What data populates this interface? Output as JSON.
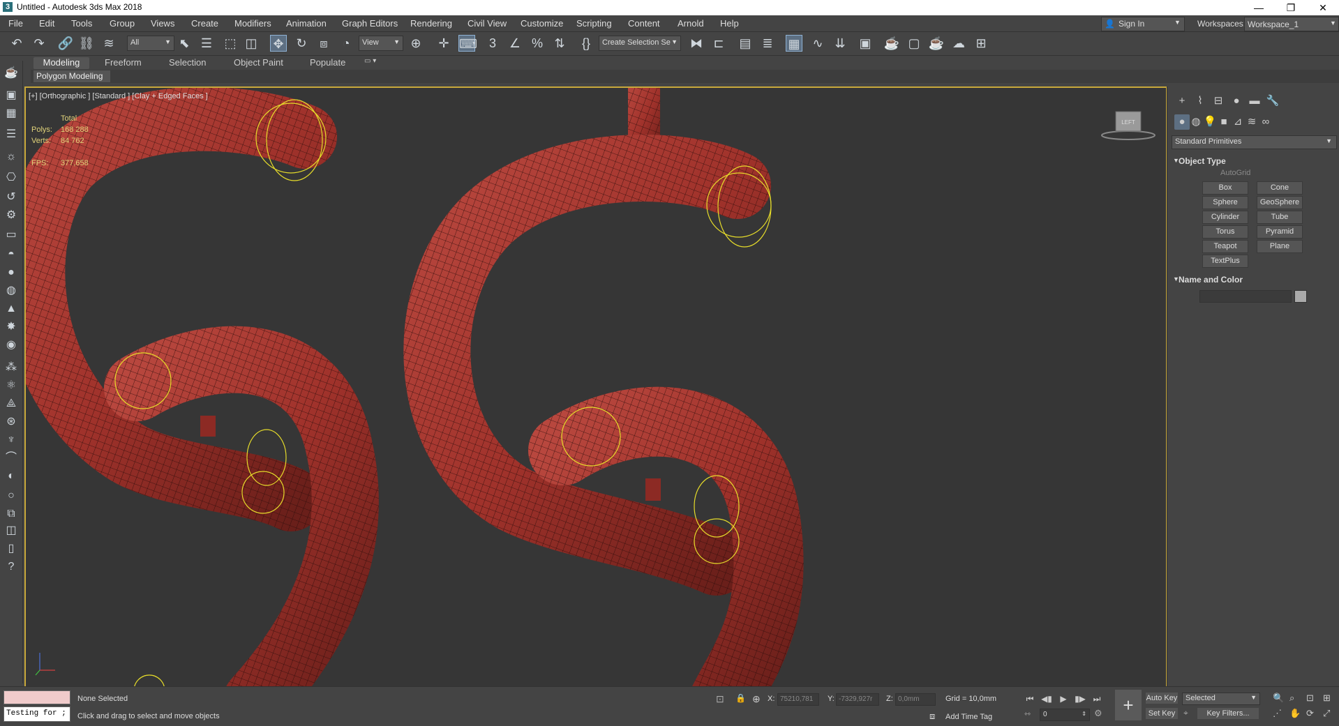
{
  "window": {
    "title": "Untitled - Autodesk 3ds Max 2018",
    "app_icon": "3",
    "controls": {
      "minimize": "—",
      "restore": "❐",
      "close": "✕"
    }
  },
  "menu": [
    "File",
    "Edit",
    "Tools",
    "Group",
    "Views",
    "Create",
    "Modifiers",
    "Animation",
    "Graph Editors",
    "Rendering",
    "Civil View",
    "Customize",
    "Scripting",
    "Content",
    "Arnold",
    "Help"
  ],
  "account": {
    "sign_in": "Sign In",
    "workspaces_label": "Workspaces:",
    "workspace_value": "Workspace_1"
  },
  "toolbar": {
    "selection_filter": "All",
    "reference_coord": "View",
    "named_selection": "Create Selection Se",
    "icons": [
      "undo-icon",
      "redo-icon",
      "link-icon",
      "unlink-icon",
      "bind-spacewarp-icon",
      "select-object-icon",
      "select-by-name-icon",
      "rect-region-icon",
      "window-crossing-icon",
      "move-icon",
      "rotate-icon",
      "scale-icon",
      "place-icon",
      "pivot-icon",
      "manipulate-icon",
      "keyboard-shortcut-icon",
      "snap-3d-icon",
      "angle-snap-icon",
      "percent-snap-icon",
      "spinner-snap-icon",
      "edit-named-sel-icon",
      "mirror-icon",
      "align-icon",
      "scene-explorer-icon",
      "layer-explorer-icon",
      "ribbon-toggle-icon",
      "curve-editor-icon",
      "schematic-view-icon",
      "material-editor-icon",
      "render-setup-icon",
      "rendered-frame-icon",
      "render-icon",
      "render-production-icon",
      "render-cloud-icon"
    ]
  },
  "ribbon": {
    "tabs": [
      "Modeling",
      "Freeform",
      "Selection",
      "Object Paint",
      "Populate"
    ],
    "active_tab": "Modeling",
    "panel": "Polygon Modeling"
  },
  "viewport": {
    "label": "[+] [Orthographic ] [Standard ] [Clay + Edged Faces ]",
    "stats": {
      "total_label": "Total",
      "polys_label": "Polys:",
      "polys": "168 288",
      "verts_label": "Verts:",
      "verts": "84 762",
      "fps_label": "FPS:",
      "fps": "377,658"
    },
    "viewcube_face": "LEFT",
    "colors": {
      "object": "#a0322b",
      "wire": "#2a0c0a",
      "gizmo": "#e6dc2a",
      "border": "#c9a93b",
      "background": "#363636"
    }
  },
  "command_panel": {
    "tabs": [
      "create-icon",
      "modify-icon",
      "hierarchy-icon",
      "motion-icon",
      "display-icon",
      "utilities-icon"
    ],
    "categories": [
      "geometry-icon",
      "shapes-icon",
      "lights-icon",
      "cameras-icon",
      "helpers-icon",
      "spacewarps-icon",
      "systems-icon"
    ],
    "primitive_type": "Standard Primitives",
    "object_type_title": "Object Type",
    "autogrid": "AutoGrid",
    "buttons": [
      "Box",
      "Cone",
      "Sphere",
      "GeoSphere",
      "Cylinder",
      "Tube",
      "Torus",
      "Pyramid",
      "Teapot",
      "Plane",
      "TextPlus"
    ],
    "name_and_color_title": "Name and Color"
  },
  "status": {
    "maxscript_text": "Testing for ;",
    "selection": "None Selected",
    "prompt": "Click and drag to select and move objects",
    "x_label": "X:",
    "x": "75210,781",
    "y_label": "Y:",
    "y": "-7329,927r",
    "z_label": "Z:",
    "z": "0,0mm",
    "grid": "Grid = 10,0mm",
    "add_time_tag": "Add Time Tag",
    "frame": "0",
    "auto_key": "Auto Key",
    "set_key": "Set Key",
    "key_mode": "Selected",
    "key_filters": "Key Filters..."
  }
}
